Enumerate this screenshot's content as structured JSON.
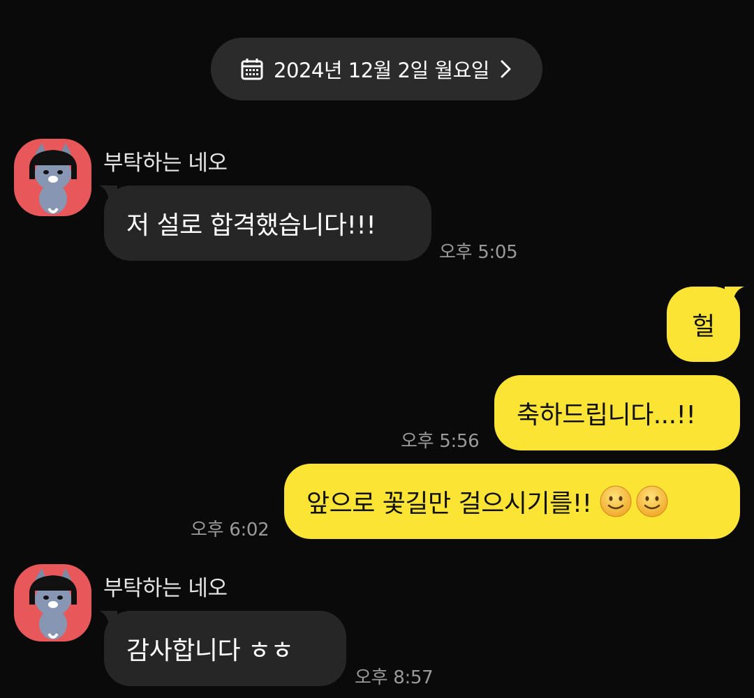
{
  "date_header": {
    "label": "2024년 12월 2일 월요일",
    "icon_left": "calendar-icon",
    "icon_right": "chevron-right-icon"
  },
  "messages": [
    {
      "direction": "incoming",
      "sender": "부탁하는 네오",
      "text": "저 설로 합격했습니다!!!",
      "time": "오후 5:05"
    },
    {
      "direction": "outgoing",
      "text": "헐",
      "time": ""
    },
    {
      "direction": "outgoing",
      "text": "축하드립니다...!!",
      "time": "오후 5:56"
    },
    {
      "direction": "outgoing",
      "text": "앞으로 꽃길만 걸으시기를!!",
      "emoji": [
        "slightly-smiling-face",
        "slightly-smiling-face"
      ],
      "time": "오후 6:02"
    },
    {
      "direction": "incoming",
      "sender": "부탁하는 네오",
      "text": "감사합니다 ㅎㅎ",
      "time": "오후 8:57"
    }
  ],
  "colors": {
    "background": "#0a0a0a",
    "incoming_bubble": "#262626",
    "outgoing_bubble": "#fce435",
    "avatar_bg": "#e8585a",
    "timestamp": "#9a9a9a"
  }
}
